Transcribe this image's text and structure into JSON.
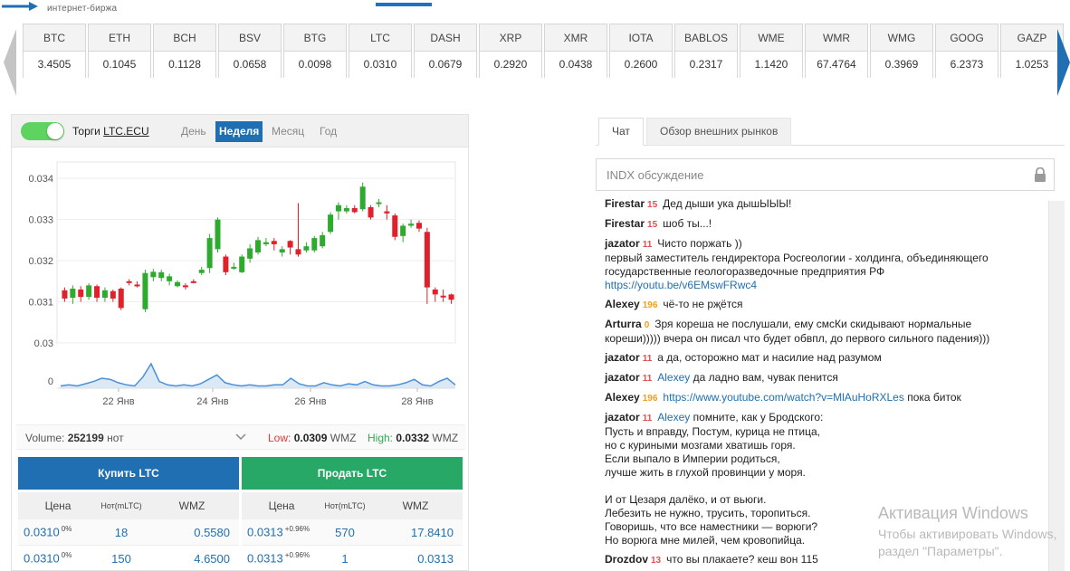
{
  "logo": {
    "subtitle": "интернет-биржа"
  },
  "tickers": [
    {
      "symbol": "BTC",
      "value": "3.4505"
    },
    {
      "symbol": "ETH",
      "value": "0.1045"
    },
    {
      "symbol": "BCH",
      "value": "0.1128"
    },
    {
      "symbol": "BSV",
      "value": "0.0658"
    },
    {
      "symbol": "BTG",
      "value": "0.0098"
    },
    {
      "symbol": "LTC",
      "value": "0.0310"
    },
    {
      "symbol": "DASH",
      "value": "0.0679"
    },
    {
      "symbol": "XRP",
      "value": "0.2920"
    },
    {
      "symbol": "XMR",
      "value": "0.0438"
    },
    {
      "symbol": "IOTA",
      "value": "0.2600"
    },
    {
      "symbol": "BABLOS",
      "value": "0.2317"
    },
    {
      "symbol": "WME",
      "value": "1.1420"
    },
    {
      "symbol": "WMR",
      "value": "67.4764"
    },
    {
      "symbol": "WMG",
      "value": "0.3969"
    },
    {
      "symbol": "GOOG",
      "value": "6.2373"
    },
    {
      "symbol": "GAZP",
      "value": "1.0253"
    }
  ],
  "trade": {
    "label": "Торги",
    "pair": "LTC.ECU",
    "periods": [
      "День",
      "Неделя",
      "Месяц",
      "Год"
    ],
    "active_period": "Неделя"
  },
  "chart_data": {
    "type": "candlestick",
    "y_ticks": [
      "0.034",
      "0.033",
      "0.032",
      "0.031",
      "0.03"
    ],
    "ylim": [
      0.03,
      0.0344
    ],
    "x_ticks": [
      "22 Янв",
      "24 Янв",
      "26 Янв",
      "28 Янв"
    ],
    "volume_tick": "0",
    "candles": [
      {
        "o": 0.03128,
        "c": 0.03108,
        "h": 0.03135,
        "l": 0.031
      },
      {
        "o": 0.0311,
        "c": 0.03132,
        "h": 0.0314,
        "l": 0.03095
      },
      {
        "o": 0.0313,
        "c": 0.03112,
        "h": 0.03138,
        "l": 0.031
      },
      {
        "o": 0.03112,
        "c": 0.0314,
        "h": 0.03145,
        "l": 0.03105
      },
      {
        "o": 0.03138,
        "c": 0.0311,
        "h": 0.03142,
        "l": 0.031
      },
      {
        "o": 0.0311,
        "c": 0.03128,
        "h": 0.03135,
        "l": 0.031
      },
      {
        "o": 0.03126,
        "c": 0.03108,
        "h": 0.0313,
        "l": 0.031
      },
      {
        "o": 0.03132,
        "c": 0.03085,
        "h": 0.03135,
        "l": 0.0308
      },
      {
        "o": 0.0315,
        "c": 0.03148,
        "h": 0.03155,
        "l": 0.0314
      },
      {
        "o": 0.03142,
        "c": 0.0314,
        "h": 0.0315,
        "l": 0.03135
      },
      {
        "o": 0.03082,
        "c": 0.0317,
        "h": 0.03178,
        "l": 0.03075
      },
      {
        "o": 0.0316,
        "c": 0.03173,
        "h": 0.0318,
        "l": 0.0315
      },
      {
        "o": 0.03158,
        "c": 0.03172,
        "h": 0.03178,
        "l": 0.0315
      },
      {
        "o": 0.0315,
        "c": 0.03162,
        "h": 0.03168,
        "l": 0.0314
      },
      {
        "o": 0.03138,
        "c": 0.03148,
        "h": 0.03152,
        "l": 0.03135
      },
      {
        "o": 0.0314,
        "c": 0.03138,
        "h": 0.03145,
        "l": 0.0313
      },
      {
        "o": 0.0315,
        "c": 0.03148,
        "h": 0.03155,
        "l": 0.03145
      },
      {
        "o": 0.0317,
        "c": 0.03178,
        "h": 0.03185,
        "l": 0.03165
      },
      {
        "o": 0.03182,
        "c": 0.03255,
        "h": 0.03265,
        "l": 0.0317
      },
      {
        "o": 0.03228,
        "c": 0.033,
        "h": 0.03305,
        "l": 0.0322
      },
      {
        "o": 0.0321,
        "c": 0.03172,
        "h": 0.03215,
        "l": 0.03165
      },
      {
        "o": 0.03182,
        "c": 0.03185,
        "h": 0.03195,
        "l": 0.03178
      },
      {
        "o": 0.03172,
        "c": 0.0321,
        "h": 0.03215,
        "l": 0.0317
      },
      {
        "o": 0.03205,
        "c": 0.0323,
        "h": 0.0324,
        "l": 0.03195
      },
      {
        "o": 0.0322,
        "c": 0.0325,
        "h": 0.03258,
        "l": 0.03215
      },
      {
        "o": 0.0324,
        "c": 0.03245,
        "h": 0.03255,
        "l": 0.03235
      },
      {
        "o": 0.03248,
        "c": 0.0324,
        "h": 0.03255,
        "l": 0.03225
      },
      {
        "o": 0.0322,
        "c": 0.03228,
        "h": 0.03235,
        "l": 0.0321
      },
      {
        "o": 0.03248,
        "c": 0.03232,
        "h": 0.0325,
        "l": 0.03215
      },
      {
        "o": 0.03228,
        "c": 0.03215,
        "h": 0.0334,
        "l": 0.0321
      },
      {
        "o": 0.03225,
        "c": 0.03235,
        "h": 0.03245,
        "l": 0.0322
      },
      {
        "o": 0.03225,
        "c": 0.03255,
        "h": 0.0326,
        "l": 0.0322
      },
      {
        "o": 0.03235,
        "c": 0.03262,
        "h": 0.0327,
        "l": 0.0323
      },
      {
        "o": 0.0327,
        "c": 0.03312,
        "h": 0.03318,
        "l": 0.03265
      },
      {
        "o": 0.0332,
        "c": 0.03335,
        "h": 0.03342,
        "l": 0.033
      },
      {
        "o": 0.0332,
        "c": 0.03328,
        "h": 0.03335,
        "l": 0.03315
      },
      {
        "o": 0.03328,
        "c": 0.03318,
        "h": 0.03335,
        "l": 0.03315
      },
      {
        "o": 0.03325,
        "c": 0.0338,
        "h": 0.0339,
        "l": 0.0332
      },
      {
        "o": 0.0333,
        "c": 0.03305,
        "h": 0.03335,
        "l": 0.033
      },
      {
        "o": 0.03338,
        "c": 0.03342,
        "h": 0.0335,
        "l": 0.0333
      },
      {
        "o": 0.0332,
        "c": 0.03315,
        "h": 0.03335,
        "l": 0.033
      },
      {
        "o": 0.0331,
        "c": 0.03258,
        "h": 0.03315,
        "l": 0.0325
      },
      {
        "o": 0.0326,
        "c": 0.03285,
        "h": 0.0329,
        "l": 0.03245
      },
      {
        "o": 0.03285,
        "c": 0.0329,
        "h": 0.033,
        "l": 0.0328
      },
      {
        "o": 0.03292,
        "c": 0.03278,
        "h": 0.03298,
        "l": 0.0327
      },
      {
        "o": 0.0327,
        "c": 0.03135,
        "h": 0.0328,
        "l": 0.03095
      },
      {
        "o": 0.0313,
        "c": 0.03118,
        "h": 0.03135,
        "l": 0.031
      },
      {
        "o": 0.03115,
        "c": 0.03112,
        "h": 0.0313,
        "l": 0.031
      },
      {
        "o": 0.03118,
        "c": 0.03105,
        "h": 0.0312,
        "l": 0.03095
      }
    ],
    "volume_series": [
      2,
      3,
      2,
      4,
      6,
      9,
      8,
      5,
      3,
      2,
      10,
      22,
      6,
      3,
      2,
      3,
      2,
      4,
      8,
      12,
      5,
      3,
      2,
      3,
      2,
      2,
      3,
      3,
      9,
      4,
      2,
      2,
      5,
      3,
      2,
      4,
      3,
      6,
      3,
      2,
      2,
      3,
      5,
      8,
      3,
      2,
      6,
      9,
      3
    ]
  },
  "volume": {
    "label": "Volume:",
    "value": "252199",
    "unit": "нот"
  },
  "low": {
    "label": "Low:",
    "value": "0.0309",
    "unit": "WMZ"
  },
  "high": {
    "label": "High:",
    "value": "0.0332",
    "unit": "WMZ"
  },
  "buttons": {
    "buy": "Купить LTC",
    "sell": "Продать LTC"
  },
  "orderbook_headers": {
    "price": "Цена",
    "amount": "Нот(mLTC)",
    "total": "WMZ"
  },
  "buy_orders": [
    {
      "price": "0.0310",
      "pct": "0%",
      "amount": "18",
      "total": "0.5580"
    },
    {
      "price": "0.0310",
      "pct": "0%",
      "amount": "150",
      "total": "4.6500"
    }
  ],
  "sell_orders": [
    {
      "price": "0.0313",
      "pct": "+0.96%",
      "amount": "570",
      "total": "17.8410"
    },
    {
      "price": "0.0313",
      "pct": "+0.96%",
      "amount": "1",
      "total": "0.0313"
    }
  ],
  "chat": {
    "tabs": [
      "Чат",
      "Обзор внешних рынков"
    ],
    "input_placeholder": "INDX обсуждение",
    "messages": [
      {
        "nick": "Firestar",
        "level": "15",
        "text": "Дед дыши ука дышЫЫЫ!"
      },
      {
        "nick": "Firestar",
        "level": "15",
        "text": "шоб ты...!"
      },
      {
        "nick": "jazator",
        "level": "11",
        "text": "Чисто поржать ))\nпервый заместитель гендиректора Росгеологии - холдинга, объединяющего\nгосударственные геологоразведочные предприятия РФ",
        "link": "https://youtu.be/v6EMswFRwc4"
      },
      {
        "nick": "Alexey",
        "level": "196",
        "text": "чё-то не рҗётся"
      },
      {
        "nick": "Arturra",
        "level": "0",
        "text": "Зря кореша не послушали, ему смсКи скидывают нормальные\nкореши))))) вчера он писал что будет обвпл, до первого сильного падения)))"
      },
      {
        "nick": "jazator",
        "level": "11",
        "text": "а да, осторожно мат и насилие над разумом"
      },
      {
        "nick": "jazator",
        "level": "11",
        "mention": "Alexey",
        "text": "да ладно вам, чувак пенится"
      },
      {
        "nick": "Alexey",
        "level": "196",
        "link": "https://www.youtube.com/watch?v=MlAuHoRXLes",
        "text": "пока биток"
      },
      {
        "nick": "jazator",
        "level": "11",
        "mention": "Alexey",
        "text": "помните, как у Бродского:\nПусть и вправду, Постум, курица не птица,\nно с куриными мозгами хватишь горя.\nЕсли выпало в Империи родиться,\nлучше жить в глухой провинции у моря.\n\nИ от Цезаря далёко, и от вьюги.\nЛебезить не нужно, трусить, торопиться.\nГоворишь, что все наместники — ворюги?\nНо ворюга мне милей, чем кровопийца."
      },
      {
        "nick": "Drozdov",
        "level": "13",
        "text": "что вы плакаете? кеш вон 115"
      }
    ]
  },
  "watermark": {
    "line1": "Активация Windows",
    "line2": "Чтобы активировать Windows,",
    "line3": "раздел \"Параметры\"."
  },
  "colors": {
    "up": "#2eaa2e",
    "down": "#e0202a",
    "accent": "#1f6fb2",
    "sell": "#27a866",
    "volume_line": "#4a90d9"
  }
}
